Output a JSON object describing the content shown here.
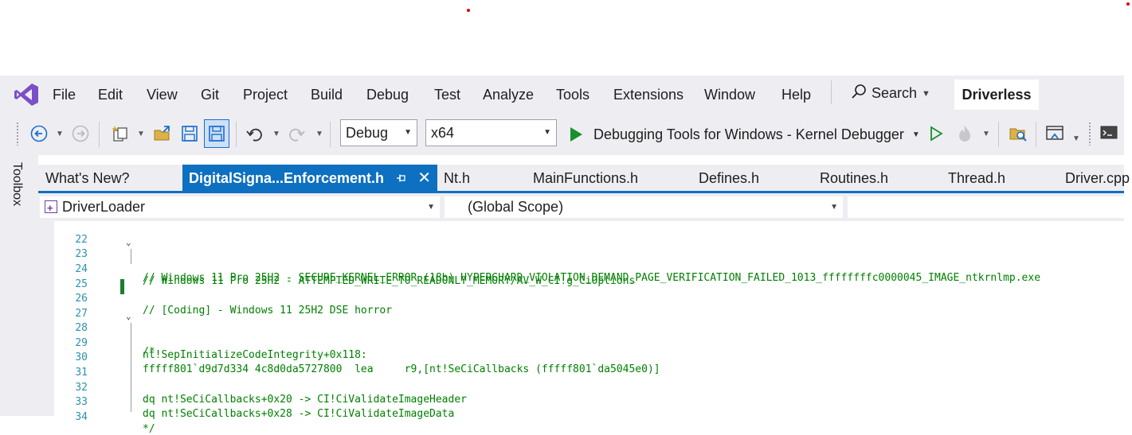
{
  "menubar": {
    "items": [
      "File",
      "Edit",
      "View",
      "Git",
      "Project",
      "Build",
      "Debug",
      "Test",
      "Analyze",
      "Tools",
      "Extensions",
      "Window",
      "Help"
    ],
    "search_label": "Search",
    "solution_name": "Driverless"
  },
  "toolbar": {
    "configuration": "Debug",
    "platform": "x64",
    "debug_target": "Debugging Tools for Windows - Kernel Debugger"
  },
  "toolbox": {
    "label": "Toolbox"
  },
  "tabs": [
    {
      "label": "What's New?"
    },
    {
      "label": "DigitalSigna...Enforcement.h",
      "active": true
    },
    {
      "label": "Nt.h"
    },
    {
      "label": "MainFunctions.h"
    },
    {
      "label": "Defines.h"
    },
    {
      "label": "Routines.h"
    },
    {
      "label": "Thread.h"
    },
    {
      "label": "Driver.cpp"
    }
  ],
  "navbar": {
    "project": "DriverLoader",
    "scope": "(Global Scope)"
  },
  "editor": {
    "lines": [
      {
        "num": "22",
        "text": ""
      },
      {
        "num": "23",
        "text": "// Windows 11 Pro 25H2 - SECURE_KERNEL_ERROR (18b) HYPERGUARD_VIOLATION_DEMAND_PAGE_VERIFICATION_FAILED_1013_ffffffffc0000045_IMAGE_ntkrnlmp.exe"
      },
      {
        "num": "24",
        "text": "// Windows 11 Pro 25H2 - ATTEMPTED_WRITE_TO_READONLY_MEMORY/AV_W_CI!g_CiOptions"
      },
      {
        "num": "25",
        "text": ""
      },
      {
        "num": "26",
        "text": "// [Coding] - Windows 11 25H2 DSE horror"
      },
      {
        "num": "27",
        "text": ""
      },
      {
        "num": "28",
        "text": "/*"
      },
      {
        "num": "29",
        "text": "nt!SepInitializeCodeIntegrity+0x118:"
      },
      {
        "num": "30",
        "text": "fffff801`d9d7d334 4c8d0da5727800  lea     r9,[nt!SeCiCallbacks (fffff801`da5045e0)]"
      },
      {
        "num": "31",
        "text": ""
      },
      {
        "num": "32",
        "text": "dq nt!SeCiCallbacks+0x20 -> CI!CiValidateImageHeader"
      },
      {
        "num": "33",
        "text": "dq nt!SeCiCallbacks+0x28 -> CI!CiValidateImageData"
      },
      {
        "num": "34",
        "text": "*/"
      }
    ]
  }
}
